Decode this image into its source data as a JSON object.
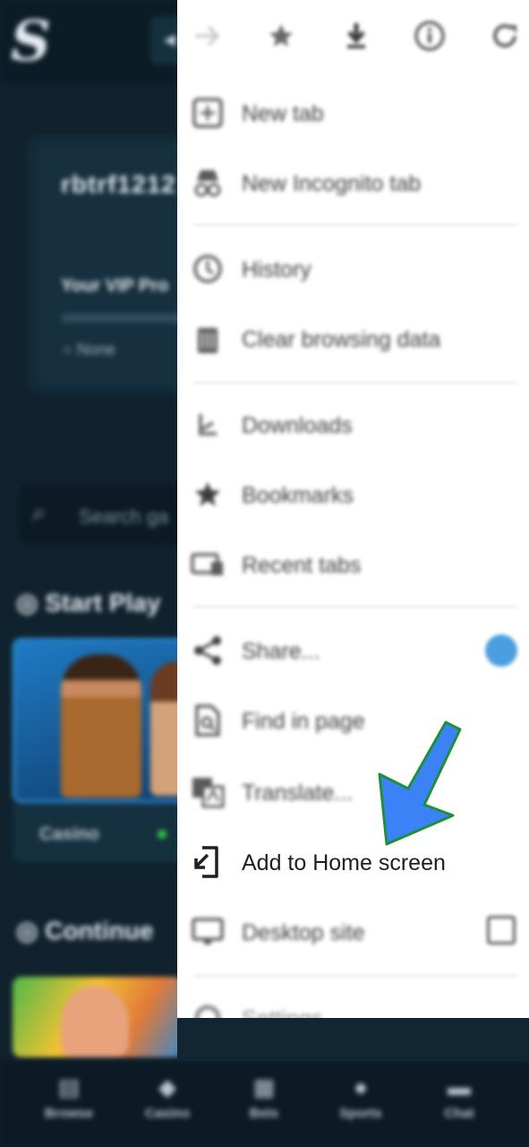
{
  "site": {
    "logo": "S",
    "username": "rbtrf1212",
    "vip_progress_label": "Your VIP Pro",
    "vip_level": "None",
    "search_placeholder": "Search ga",
    "section_start": "Start Play",
    "game_category": "Casino",
    "section_continue": "Continue",
    "bottom_nav": [
      "Browse",
      "Casino",
      "Bets",
      "Sports",
      "Chat"
    ]
  },
  "menu": {
    "toolbar_icons": [
      "forward-icon",
      "star-icon",
      "download-icon",
      "info-icon",
      "refresh-icon"
    ],
    "groups": [
      [
        {
          "label": "New tab",
          "icon": "new-tab-icon"
        },
        {
          "label": "New Incognito tab",
          "icon": "incognito-icon"
        }
      ],
      [
        {
          "label": "History",
          "icon": "history-icon"
        },
        {
          "label": "Clear browsing data",
          "icon": "trash-icon"
        }
      ],
      [
        {
          "label": "Downloads",
          "icon": "downloads-icon"
        },
        {
          "label": "Bookmarks",
          "icon": "bookmark-star-icon"
        },
        {
          "label": "Recent tabs",
          "icon": "recent-tabs-icon"
        }
      ],
      [
        {
          "label": "Share...",
          "icon": "share-icon"
        },
        {
          "label": "Find in page",
          "icon": "find-in-page-icon"
        },
        {
          "label": "Translate...",
          "icon": "translate-icon"
        },
        {
          "label": "Add to Home screen",
          "icon": "add-to-home-screen-icon"
        },
        {
          "label": "Desktop site",
          "icon": "desktop-icon"
        }
      ],
      [
        {
          "label": "Settings",
          "icon": "settings-icon"
        }
      ]
    ],
    "desktop_site_checked": false
  },
  "colors": {
    "site_bg": "#10222e",
    "menu_bg": "#ffffff",
    "arrow": "#3b82f6",
    "arrow_outline": "#1f8f3a"
  }
}
